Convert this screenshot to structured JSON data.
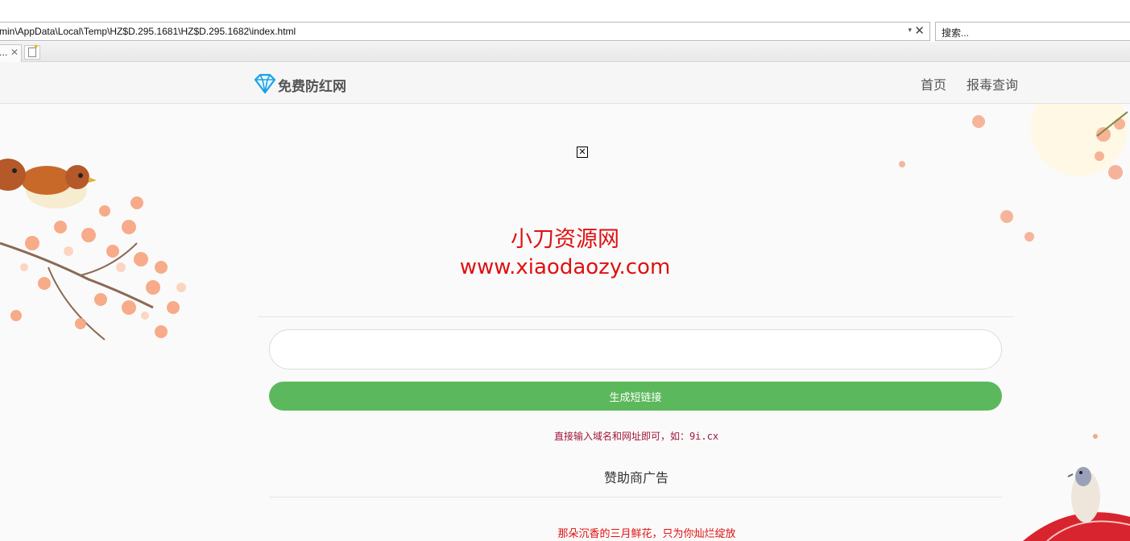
{
  "browser": {
    "address": "min\\AppData\\Local\\Temp\\HZ$D.295.1681\\HZ$D.295.1682\\index.html",
    "search_placeholder": "搜索...",
    "tab_title": "...",
    "dropdown_icon": "▾",
    "close_icon": "✕",
    "tab_close_icon": "✕",
    "new_tab_icon": "new-document-icon"
  },
  "navbar": {
    "brand": "免费防红网",
    "brand_icon": "diamond-icon",
    "links": [
      "首页",
      "报毒查询"
    ]
  },
  "hero": {
    "broken_image_icon": "✕",
    "line1": "小刀资源网",
    "line2": "www.xiaodaozy.com"
  },
  "form": {
    "input_value": "",
    "button_label": "生成短链接",
    "hint": "直接输入域名和网址即可，如：9i.cx"
  },
  "sponsor": {
    "title": "赞助商广告",
    "slogan": "那朵沉香的三月鲜花，只为你灿烂绽放"
  },
  "colors": {
    "accent_red": "#e01010",
    "button_green": "#5cb85c",
    "hint_color": "#a1173b"
  }
}
